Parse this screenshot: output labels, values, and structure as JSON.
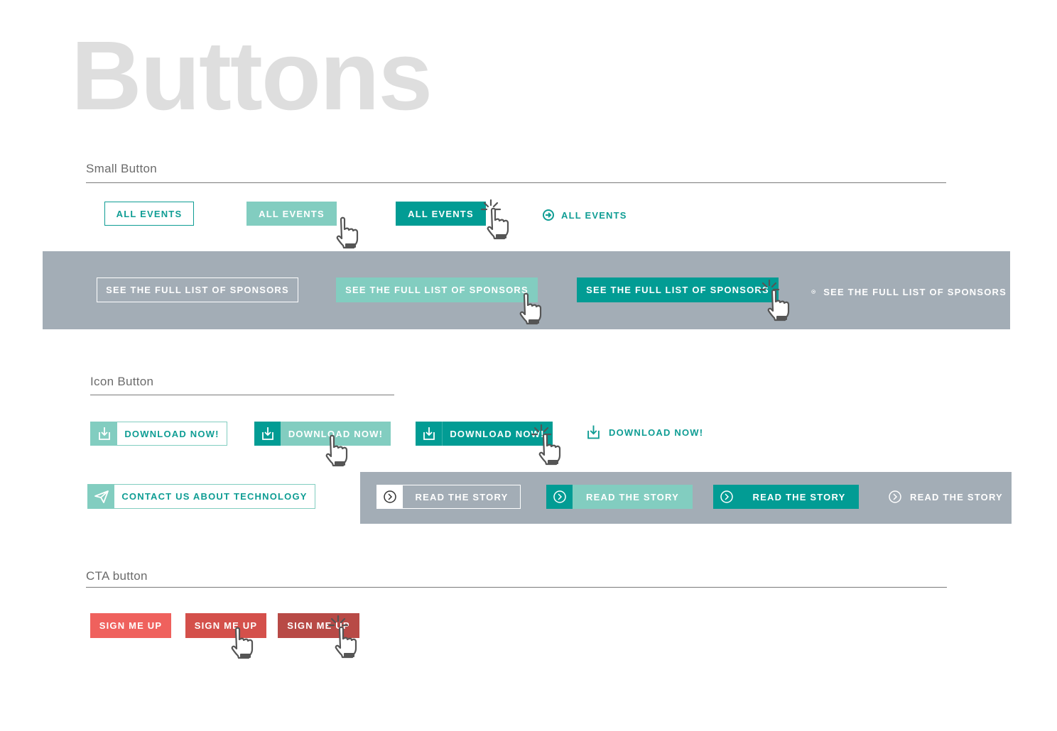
{
  "title": "Buttons",
  "sections": {
    "small": "Small Button",
    "icon": "Icon Button",
    "cta": "CTA button"
  },
  "small_buttons": {
    "outline": "ALL EVENTS",
    "hover": "ALL EVENTS",
    "active": "ALL EVENTS",
    "link": "ALL EVENTS"
  },
  "sponsor_buttons": {
    "outline": "SEE THE FULL LIST OF SPONSORS",
    "hover": "SEE THE FULL LIST OF SPONSORS",
    "active": "SEE THE FULL LIST OF SPONSORS",
    "link": "SEE THE FULL LIST OF SPONSORS"
  },
  "download_buttons": {
    "outline": "DOWNLOAD NOW!",
    "hover": "DOWNLOAD NOW!",
    "active": "DOWNLOAD NOW!",
    "link": "DOWNLOAD NOW!"
  },
  "contact_button": "CONTACT US ABOUT TECHNOLOGY",
  "story_buttons": {
    "outline": "READ THE STORY",
    "hover": "READ THE STORY",
    "active": "READ THE STORY",
    "link": "READ THE STORY"
  },
  "cta_buttons": {
    "default": "SIGN ME UP",
    "hover": "SIGN ME UP",
    "active": "SIGN ME UP"
  },
  "colors": {
    "teal": "#029c94",
    "teal_light": "#82cdc0",
    "band_gray": "#a3adb6",
    "cta_red": "#ef615d",
    "cta_hover": "#d4504b",
    "cta_active": "#b84a46",
    "title_gray": "#dedede"
  },
  "icons": [
    "hand-cursor-icon",
    "click-cursor-icon",
    "arrow-circle-icon",
    "download-icon",
    "paper-plane-icon",
    "chevron-circle-icon"
  ]
}
